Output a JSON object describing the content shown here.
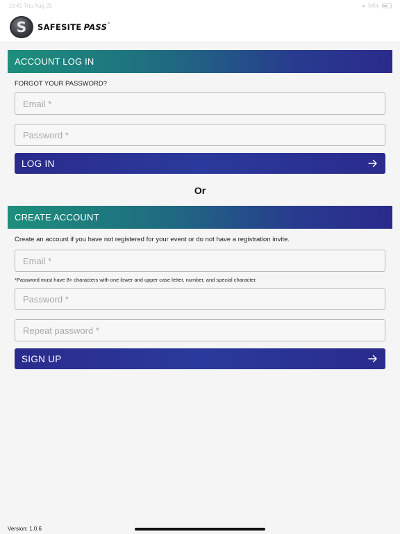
{
  "status_bar": {
    "time_date": "10:41   Thu Aug 25",
    "battery": "54%"
  },
  "brand": {
    "logo_letter": "S",
    "name_primary": "SAFESITE",
    "name_secondary": "PASS",
    "trademark": "™"
  },
  "login": {
    "title": "ACCOUNT LOG IN",
    "forgot_password": "FORGOT YOUR PASSWORD?",
    "email_placeholder": "Email *",
    "password_placeholder": "Password *",
    "submit_label": "LOG IN"
  },
  "divider_text": "Or",
  "create": {
    "title": "CREATE ACCOUNT",
    "description": "Create an account if you have not registered for your event or do not have a registration invite.",
    "email_placeholder": "Email *",
    "password_hint": "*Password must have 8+ characters with one lower and upper case letter, number, and special character.",
    "password_placeholder": "Password *",
    "repeat_password_placeholder": "Repeat password *",
    "submit_label": "SIGN UP"
  },
  "footer": {
    "version": "Version: 1.0.6"
  },
  "colors": {
    "header_gradient_start": "#1d8f7c",
    "header_gradient_end": "#2b2a8c",
    "button_color": "#2a2b8c",
    "background": "#f5f5f6"
  }
}
